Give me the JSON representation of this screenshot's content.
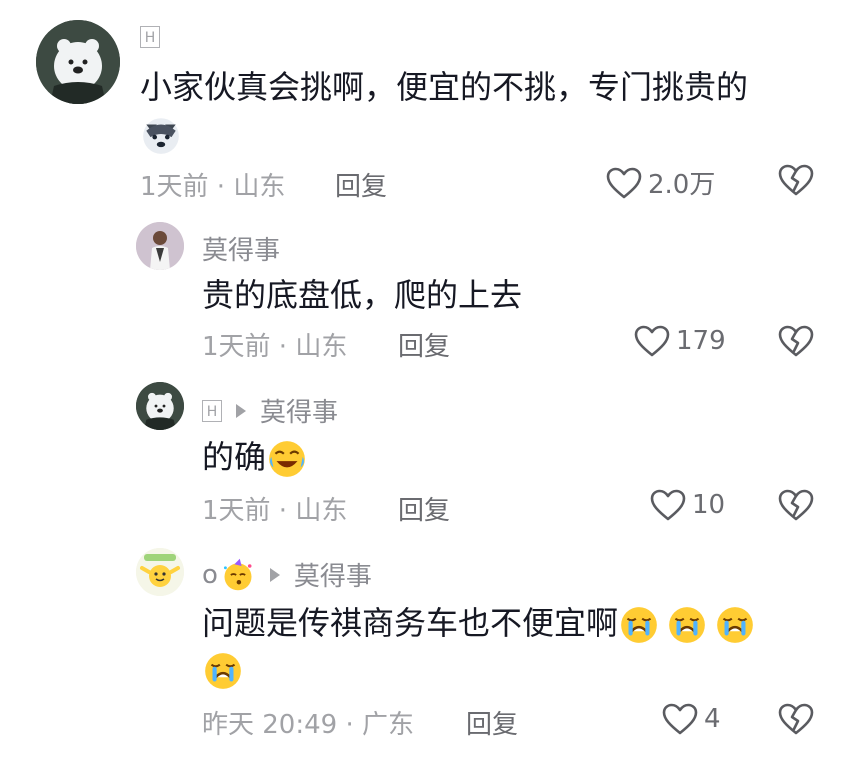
{
  "comments": [
    {
      "username": "H",
      "text": "小家伙真会挑啊，便宜的不挑，专门挑贵的",
      "time": "1天前 · 山东",
      "reply_label": "回复",
      "likes": "2.0万"
    },
    {
      "username": "莫得事",
      "text": "贵的底盘低，爬的上去",
      "time": "1天前 · 山东",
      "reply_label": "回复",
      "likes": "179"
    },
    {
      "username": "H",
      "reply_to": "莫得事",
      "text": "的确",
      "time": "1天前 · 山东",
      "reply_label": "回复",
      "likes": "10"
    },
    {
      "username": "o",
      "reply_to": "莫得事",
      "text": "问题是传祺商务车也不便宜啊",
      "time": "昨天 20:49 · 广东",
      "reply_label": "回复",
      "likes": "4"
    }
  ]
}
